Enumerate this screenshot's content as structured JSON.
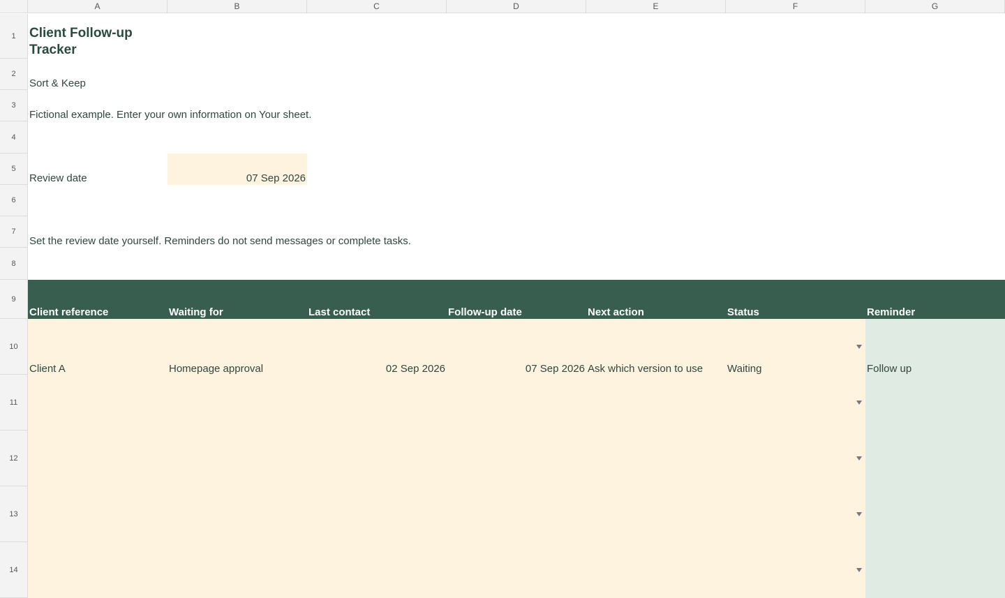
{
  "columns": [
    "A",
    "B",
    "C",
    "D",
    "E",
    "F",
    "G"
  ],
  "rows": [
    "1",
    "2",
    "3",
    "4",
    "5",
    "6",
    "7",
    "8",
    "9",
    "10",
    "11",
    "12",
    "13",
    "14"
  ],
  "title": "Client Follow-up Tracker",
  "subtitle": "Sort & Keep",
  "note": "Fictional example. Enter your own information on Your sheet.",
  "review": {
    "label": "Review date",
    "value": "07 Sep 2026"
  },
  "instruction": "Set the review date yourself. Reminders do not send messages or complete tasks.",
  "table": {
    "headers": [
      "Client reference",
      "Waiting for",
      "Last contact",
      "Follow-up date",
      "Next action",
      "Status",
      "Reminder"
    ],
    "rows": [
      {
        "client_reference": "Client A",
        "waiting_for": "Homepage approval",
        "last_contact": "02 Sep 2026",
        "follow_up_date": "07 Sep 2026",
        "next_action": "Ask which version to use",
        "status": "Waiting",
        "reminder": "Follow up"
      }
    ]
  },
  "colors": {
    "header_band": "#375e4e",
    "input_fill": "#fef3de",
    "reminder_fill": "#e0ebe3",
    "title_text": "#2a4a3f"
  },
  "icons": [
    "dropdown-arrow-icon"
  ]
}
